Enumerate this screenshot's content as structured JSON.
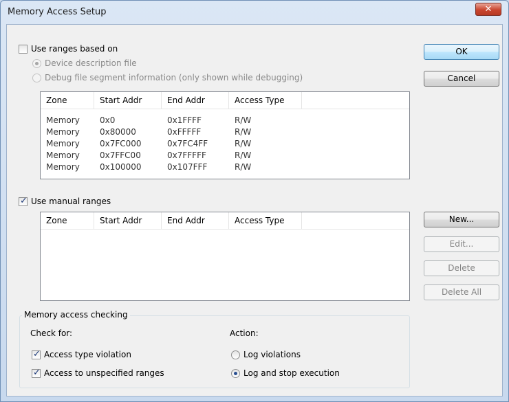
{
  "window": {
    "title": "Memory Access Setup",
    "close_label": "✕"
  },
  "ranges": {
    "checkbox_label": "Use ranges based on",
    "checked": false,
    "radio_device": "Device description file",
    "radio_debug": "Debug file segment information  (only shown while debugging)",
    "columns": [
      "Zone",
      "Start Addr",
      "End Addr",
      "Access Type"
    ],
    "rows": [
      [
        "Memory",
        "0x0",
        "0x1FFFF",
        "R/W"
      ],
      [
        "Memory",
        "0x80000",
        "0xFFFFF",
        "R/W"
      ],
      [
        "Memory",
        "0x7FC000",
        "0x7FC4FF",
        "R/W"
      ],
      [
        "Memory",
        "0x7FFC00",
        "0x7FFFFF",
        "R/W"
      ],
      [
        "Memory",
        "0x100000",
        "0x107FFF",
        "R/W"
      ]
    ]
  },
  "manual": {
    "checkbox_label": "Use manual ranges",
    "checked": true,
    "columns": [
      "Zone",
      "Start Addr",
      "End Addr",
      "Access Type"
    ]
  },
  "buttons": {
    "ok": "OK",
    "cancel": "Cancel",
    "new": "New...",
    "edit": "Edit...",
    "delete": "Delete",
    "delete_all": "Delete All"
  },
  "checking": {
    "group_title": "Memory access checking",
    "check_for": "Check for:",
    "access_type": "Access type violation",
    "unspecified": "Access to unspecified ranges",
    "action": "Action:",
    "log_violations": "Log violations",
    "log_stop": "Log and stop execution"
  }
}
